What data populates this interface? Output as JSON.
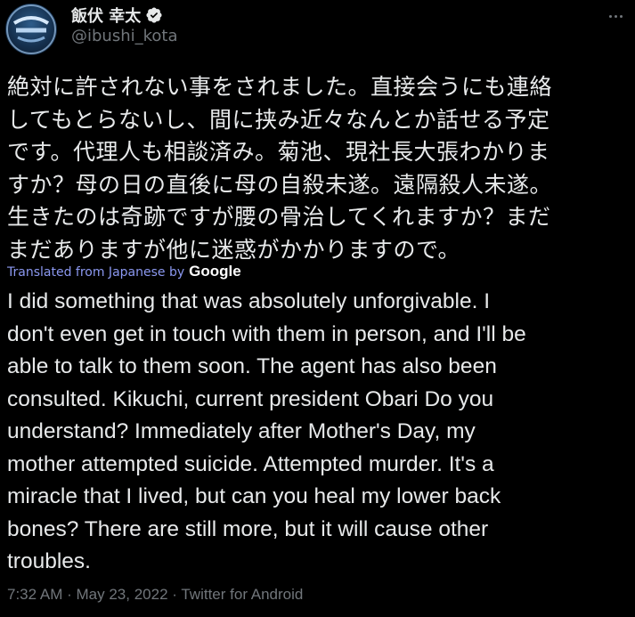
{
  "user": {
    "display_name": "飯伏 幸太",
    "handle": "@ibushi_kota",
    "verified_icon": "verified-badge-icon",
    "avatar_icon": "avatar"
  },
  "tweet": {
    "text_ja_lines": [
      "絶対に許されない事をされました。直接会うにも連絡",
      "してもとらないし、間に挟み近々なんとか話せる予定",
      "です。代理人も相談済み。菊池、現社長大張わかりま",
      "すか？母の日の直後に母の自殺未遂。遠隔殺人未遂。",
      "生きたのは奇跡ですが腰の骨治してくれますか？まだ",
      "まだありますが他に迷惑がかかりますので。"
    ],
    "translated_prefix": "Translated from Japanese by",
    "translator": "Google",
    "text_en_lines": [
      "I did something that was absolutely unforgivable. I",
      "don't even get in touch with them in person, and I'll be",
      "able to talk to them soon. The agent has also been",
      "consulted. Kikuchi, current president Obari Do you",
      "understand? Immediately after Mother's Day, my",
      "mother attempted suicide. Attempted murder. It's a",
      "miracle that I lived, but can you heal my lower back",
      "bones? There are still more, but it will cause other",
      "troubles."
    ],
    "time": "7:32 AM",
    "separator": "·",
    "date": "May 23, 2022",
    "source": "Twitter for Android"
  },
  "colors": {
    "background": "#000000",
    "text": "#e7e9ea",
    "secondary": "#71767b",
    "translate_link": "#8b98f0",
    "verified": "#1d9bf0"
  }
}
